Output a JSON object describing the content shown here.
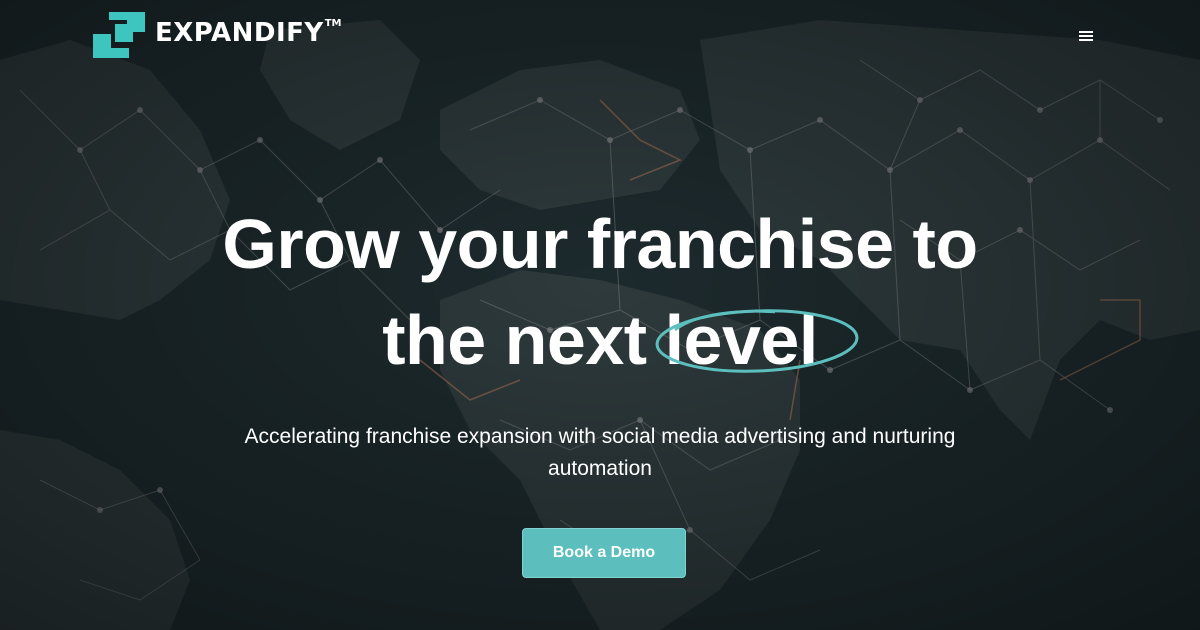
{
  "header": {
    "logo_text": "EXPANDIFY",
    "logo_trademark": "TM",
    "menu_icon": "hamburger-menu-icon"
  },
  "hero": {
    "headline_line1": "Grow your franchise to",
    "headline_line2_prefix": "the next",
    "headline_highlight": "level",
    "subheadline": "Accelerating franchise expansion with social media advertising and nurturing automation",
    "cta_label": "Book a Demo",
    "background": "world-map-network-image"
  },
  "colors": {
    "accent": "#5cbfbd",
    "logo_teal": "#3fc5c0",
    "background": "#1a2528",
    "text": "#ffffff"
  }
}
